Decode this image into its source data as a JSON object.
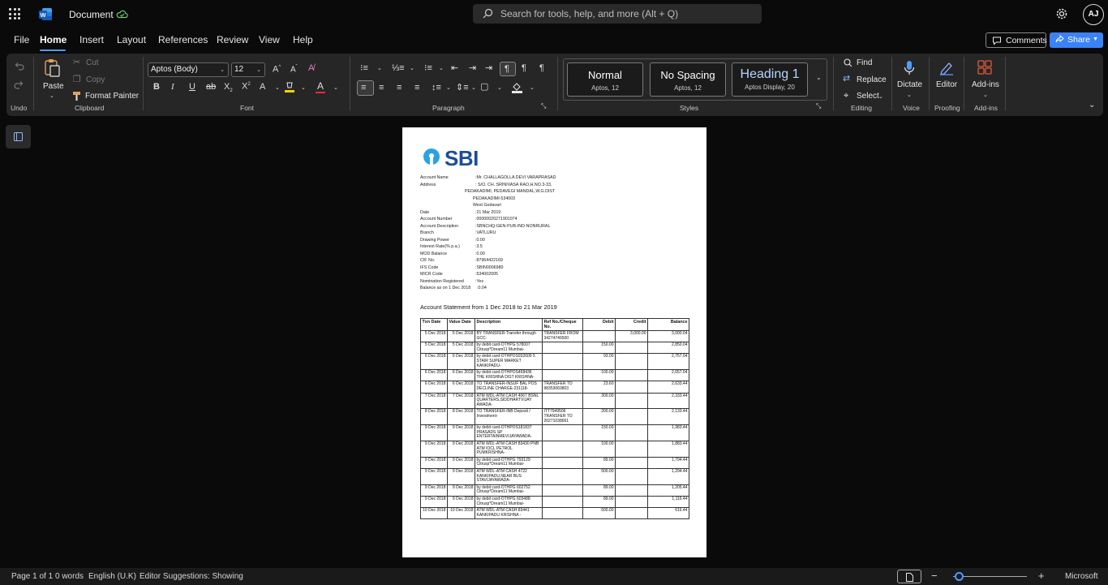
{
  "title_bar": {
    "doc_title": "Document",
    "search_placeholder": "Search for tools, help, and more (Alt + Q)",
    "avatar_initials": "AJ"
  },
  "menu": {
    "items": [
      "File",
      "Home",
      "Insert",
      "Layout",
      "References",
      "Review",
      "View",
      "Help"
    ],
    "active": "Home",
    "comments_label": "Comments",
    "share_label": "Share"
  },
  "ribbon": {
    "clipboard": {
      "paste": "Paste",
      "cut": "Cut",
      "copy": "Copy",
      "format_painter": "Format Painter",
      "label": "Clipboard"
    },
    "undo_label": "Undo",
    "font": {
      "name": "Aptos (Body)",
      "size": "12",
      "label": "Font"
    },
    "paragraph_label": "Paragraph",
    "styles": {
      "items": [
        {
          "name": "Normal",
          "sub": "Aptos, 12"
        },
        {
          "name": "No Spacing",
          "sub": "Aptos, 12"
        },
        {
          "name": "Heading 1",
          "sub": "Aptos Display, 20"
        }
      ],
      "label": "Styles"
    },
    "editing": {
      "find": "Find",
      "replace": "Replace",
      "select": "Select",
      "label": "Editing"
    },
    "voice": {
      "dictate": "Dictate",
      "label": "Voice"
    },
    "proofing": {
      "editor": "Editor",
      "label": "Proofing"
    },
    "addins": {
      "addins": "Add-ins",
      "label": "Add-ins"
    },
    "accent_color": "#3b82f6"
  },
  "document": {
    "bank_logo_text": "SBI",
    "account_info": [
      {
        "k": "Account Name",
        "v": ":Mr. CHALLAGOLLA  DEVI VARAPRASAD"
      },
      {
        "k": "Address",
        "v": ": S/O. CH. SRINIVASA RAO,H.NO.3-33,"
      },
      {
        "k": "Date",
        "v": ":21 Mar 2019"
      },
      {
        "k": "Account Number",
        "v": ":00000020271901074"
      },
      {
        "k": "Account Description",
        "v": ":SBNCHQ-GEN-PUB-IND-NONRURAL"
      },
      {
        "k": "Branch",
        "v": ":VATLURU"
      },
      {
        "k": "Drawing Power",
        "v": ":0.00"
      },
      {
        "k": "Interest Rate(% p.a.)",
        "v": ":3.5"
      },
      {
        "k": "MOD Balance",
        "v": ":0.00"
      },
      {
        "k": "CIF No.",
        "v": ":87964422169"
      },
      {
        "k": "IFS Code",
        "v": ":SBIN0006980"
      },
      {
        "k": "MICR Code",
        "v": ":534002005"
      },
      {
        "k": "Nomination Registered",
        "v": ":Yes"
      },
      {
        "k": "Balance as on 1 Dec 2018",
        "v": ":0.04"
      }
    ],
    "address_lines": [
      "PEDAKADIMI, PEDAVEGI MANDAL,W.G.DIST",
      "PEDAKADIMI-534003",
      "West Godavari"
    ],
    "statement_title": "Account Statement from 1 Dec 2018 to 21 Mar 2019",
    "table_headers": [
      "Txn Date",
      "Value Date",
      "Description",
      "Ref No./Cheque No.",
      "Debit",
      "Credit",
      "Balance"
    ],
    "rows": [
      [
        "5 Dec 2018",
        "5 Dec 2018",
        "BY TRANSFER-Transfer through GCC-",
        "TRANSFER FROM 34274746500",
        "",
        "3,000.00",
        "3,000.04"
      ],
      [
        "5 Dec 2018",
        "5 Dec 2018",
        "by debit card-OTHPG 578007 Citrusp*Dream11      Mumbai-",
        "",
        "150.00",
        "",
        "2,850.04"
      ],
      [
        "6 Dec 2018",
        "6 Dec 2018",
        "by debit card-OTHPOS932609 5 STAIR SUPER MARKET KANKIPADU-",
        "",
        "93.00",
        "",
        "2,757.04"
      ],
      [
        "6 Dec 2018",
        "6 Dec 2018",
        "by debit card-OTHPOS458436 THE KRISHNA DIST KRISHNA-",
        "",
        "100.00",
        "",
        "2,657.04"
      ],
      [
        "6 Dec 2018",
        "6 Dec 2018",
        "TO TRANSFER-INSUF BAL POS DECLINE CHARGE-231118-",
        "TRANSFER TO 98353069803",
        "23.60",
        "",
        "2,633.44"
      ],
      [
        "7 Dec 2018",
        "7 Dec 2018",
        "ATM WDL-ATM CASH 4067 BSNL QUARTERS,SIDDHARTVIJAY AWADA-",
        "",
        "300.00",
        "",
        "2,333.44"
      ],
      [
        "8 Dec 2018",
        "8 Dec 2018",
        "TO TRANSFER-INB Deposit / Investment-",
        "ITT7949506 TRANSFER TO 20271038661",
        "200.00",
        "",
        "2,133.44"
      ],
      [
        "9 Dec 2018",
        "9 Dec 2018",
        "by debit card-OTHPOS181837 PRASADS SP ENTERTAINMEVIJAYAWADA-",
        "",
        "150.00",
        "",
        "1,983.44"
      ],
      [
        "9 Dec 2018",
        "9 Dec 2018",
        "ATM WDL-ATM CASH 83430 PNB ATM IOCL PETROL PUMKRISHNA-",
        "",
        "100.00",
        "",
        "1,883.44"
      ],
      [
        "9 Dec 2018",
        "9 Dec 2018",
        "by debit card-OTHPG 793129 Citrusp*Dream11      Mumbai-",
        "",
        "89.00",
        "",
        "1,794.44"
      ],
      [
        "9 Dec 2018",
        "9 Dec 2018",
        "ATM WDL-ATM CASH 4722 KANKIPADU,NEAR BUS STAVIJAYAWADA-",
        "",
        "500.00",
        "",
        "1,294.44"
      ],
      [
        "9 Dec 2018",
        "9 Dec 2018",
        "by debit card-OTHPG 602752 Citrusp*Dream11      Mumbai-",
        "",
        "89.00",
        "",
        "1,205.44"
      ],
      [
        "9 Dec 2018",
        "9 Dec 2018",
        "by debit card-OTHPG 603488 Citrusp*Dream11      Mumbai-",
        "",
        "89.00",
        "",
        "1,116.44"
      ],
      [
        "10 Dec 2018",
        "10 Dec 2018",
        "ATM WDL-ATM CASH 83441 KANKIPADU          KRISHNA -",
        "",
        "500.00",
        "",
        "616.44"
      ]
    ]
  },
  "status_bar": {
    "page": "Page 1 of 1",
    "words": "0 words",
    "language": "English (U.K)",
    "editor": "Editor Suggestions: Showing",
    "brand": "Microsoft"
  }
}
